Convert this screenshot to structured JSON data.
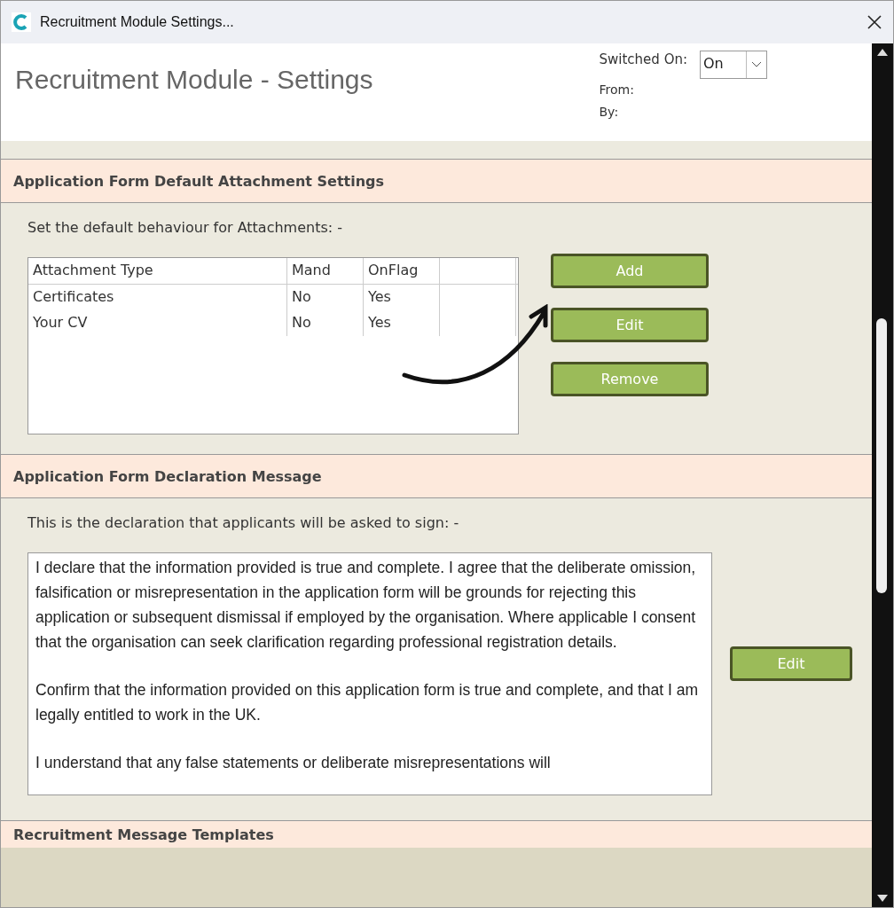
{
  "window": {
    "title": "Recruitment Module Settings..."
  },
  "header": {
    "title": "Recruitment Module - Settings",
    "switched_on_label": "Switched On:",
    "switched_on_value": "On",
    "from_label": "From:",
    "by_label": "By:"
  },
  "attachments": {
    "heading": "Application Form Default Attachment Settings",
    "intro": "Set the default behaviour for Attachments: -",
    "columns": [
      "Attachment Type",
      "Mand",
      "OnFlag"
    ],
    "rows": [
      {
        "cells": [
          "Certificates",
          "No",
          "Yes"
        ]
      },
      {
        "cells": [
          "Your CV",
          "No",
          "Yes"
        ]
      }
    ],
    "buttons": [
      "Add",
      "Edit",
      "Remove"
    ]
  },
  "declaration": {
    "heading": "Application Form Declaration Message",
    "intro": "This is the declaration that applicants will be asked to sign: -",
    "paragraphs": [
      "I declare that the information provided is true and complete. I agree that the deliberate omission, falsification or misrepresentation in the application form will be grounds for rejecting this application or subsequent dismissal if employed by the organisation. Where applicable I consent that the organisation can seek clarification regarding professional registration details.",
      "Confirm that the information provided on this application form is true and complete, and that I am legally entitled to work in the UK.",
      "I understand that any false statements or deliberate misrepresentations will"
    ],
    "button": "Edit"
  },
  "templates": {
    "heading": "Recruitment Message Templates"
  }
}
